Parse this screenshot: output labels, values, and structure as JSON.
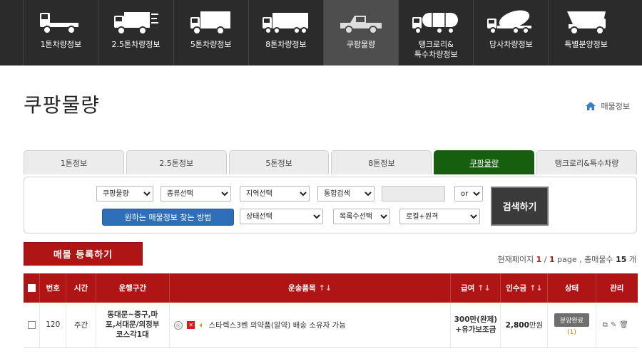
{
  "topnav": {
    "items": [
      {
        "label": "1톤차량정보"
      },
      {
        "label": "2.5톤차량정보"
      },
      {
        "label": "5톤차량정보"
      },
      {
        "label": "8톤차량정보"
      },
      {
        "label": "쿠팡물량"
      },
      {
        "label": "탱크로리&\n특수차량정보"
      },
      {
        "label": "당사차량정보"
      },
      {
        "label": "특별분양정보"
      }
    ]
  },
  "page": {
    "title": "쿠팡물량",
    "breadcrumb": "매물정보"
  },
  "tabs": [
    "1톤정보",
    "2.5톤정보",
    "5톤정보",
    "8톤정보",
    "쿠팡물량",
    "탱크로리&특수차량"
  ],
  "filter": {
    "sel1": "쿠팡물량",
    "sel2": "종류선택",
    "sel3": "지역선택",
    "sel4": "통합검색",
    "sel5": "or",
    "howto": "원하는 매물정보 찾는 방법",
    "sel6": "상태선택",
    "sel7": "목록수선택",
    "sel8": "로컬+원격",
    "search": "검색하기"
  },
  "register_button": "매물 등록하기",
  "pageinfo": {
    "prefix": "현재페이지",
    "current": "1",
    "sep": "/",
    "total": "1",
    "mid": "page , 총매물수",
    "count": "15",
    "unit": "개"
  },
  "table": {
    "headers": {
      "no": "번호",
      "time": "시간",
      "route": "운행구간",
      "cargo": "운송품목",
      "pay": "급여",
      "fee": "인수금",
      "status": "상태",
      "manage": "관리"
    },
    "rows": [
      {
        "no": "120",
        "time": "주간",
        "route1": "동대문~중구,마",
        "route2": "포,서대문/의정부",
        "route3": "코스각1대",
        "cargo": "스타렉스3벤  의약품(알약) 배송  소유자 가능",
        "pay1": "300만(완제)",
        "pay2": "+유가보조금",
        "fee_num": "2,800",
        "fee_unit": "만원",
        "status": "분양완료",
        "status_count": "(1)"
      }
    ]
  }
}
